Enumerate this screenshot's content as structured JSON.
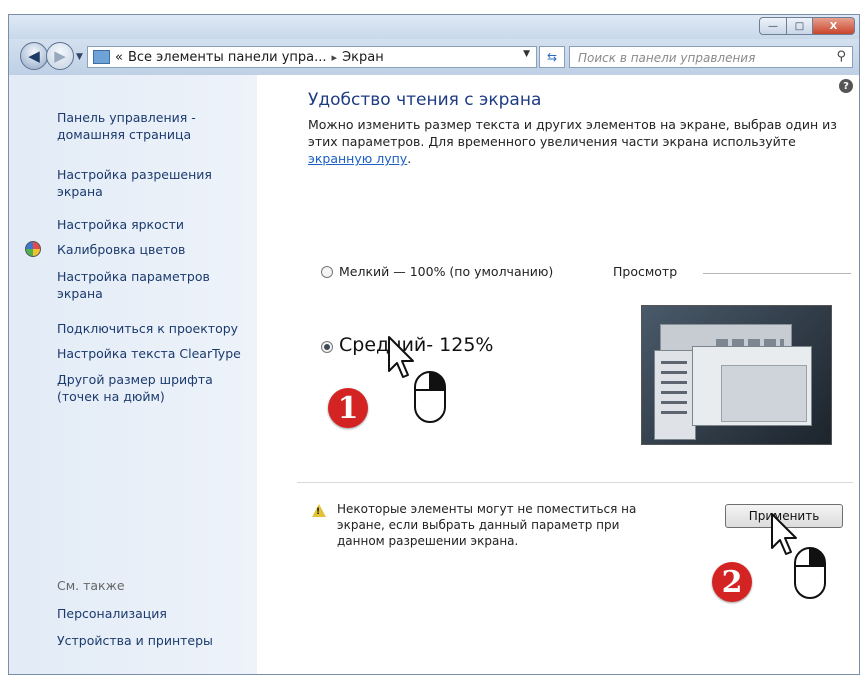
{
  "window": {
    "controls": {
      "minimize": "—",
      "maximize": "□",
      "close": "X"
    }
  },
  "navigation": {
    "back_icon": "back-arrow-icon",
    "forward_icon": "forward-arrow-icon",
    "address": {
      "prefix": "«",
      "crumb1": "Все элементы панели упра...",
      "separator": "▸",
      "crumb2": "Экран"
    },
    "search_placeholder": "Поиск в панели управления"
  },
  "sidebar": {
    "links": [
      "Панель управления - домашняя страница",
      "Настройка разрешения экрана",
      "Настройка яркости",
      "Калибровка цветов",
      "Настройка параметров экрана",
      "Подключиться к проектору",
      "Настройка текста ClearType",
      "Другой размер шрифта (точек на дюйм)"
    ],
    "see_also_label": "См. также",
    "see_also": [
      "Персонализация",
      "Устройства и принтеры"
    ]
  },
  "main": {
    "heading": "Удобство чтения с экрана",
    "description": "Можно изменить размер текста и других элементов на экране, выбрав один из этих параметров. Для временного увеличения части экрана используйте ",
    "description_link": "экранную лупу",
    "description_end": ".",
    "options": [
      {
        "label": "Мелкий — 100% (по умолчанию)",
        "checked": false
      },
      {
        "label": "Средний- 125%",
        "checked": true
      }
    ],
    "preview_label": "Просмотр",
    "warning": "Некоторые элементы могут не поместиться на экране, если выбрать данный параметр при данном разрешении экрана.",
    "apply_label": "Применить"
  },
  "annotations": {
    "step1": "1",
    "step2": "2"
  },
  "colors": {
    "heading": "#1e3c82",
    "link": "#1b3a6d",
    "badge": "#d42323",
    "sidebar_bg": "#e2ebf6"
  }
}
